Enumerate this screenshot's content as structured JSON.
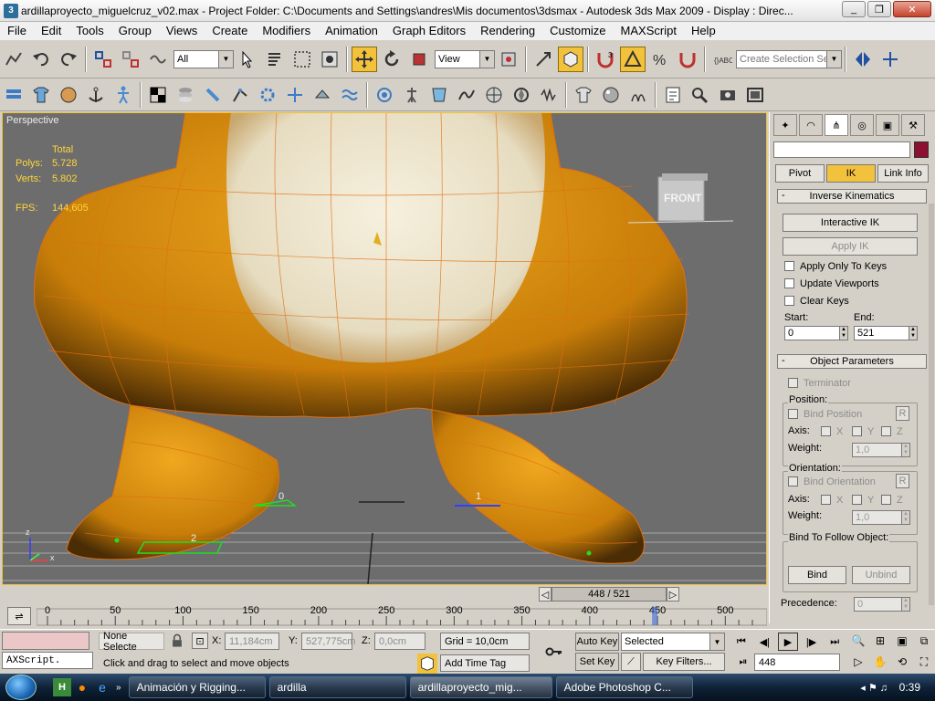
{
  "window": {
    "title": "ardillaproyecto_miguelcruz_v02.max    - Project Folder: C:\\Documents and Settings\\andres\\Mis documentos\\3dsmax    - Autodesk 3ds Max  2009      - Display : Direc..."
  },
  "menu": [
    "File",
    "Edit",
    "Tools",
    "Group",
    "Views",
    "Create",
    "Modifiers",
    "Animation",
    "Graph Editors",
    "Rendering",
    "Customize",
    "MAXScript",
    "Help"
  ],
  "toolbar": {
    "selection_filter": "All",
    "reference_coord": "View",
    "named_selection_placeholder": "Create Selection Set",
    "snap_angle": "3"
  },
  "viewport": {
    "label": "Perspective",
    "stats_header": "Total",
    "polys_label": "Polys:",
    "polys_value": "5.728",
    "verts_label": "Verts:",
    "verts_value": "5.802",
    "fps_label": "FPS:",
    "fps_value": "144,605",
    "viewcube_label": "FRONT",
    "marker_0": "0",
    "marker_1": "1",
    "marker_2": "2",
    "axis_z": "z",
    "axis_x": "x"
  },
  "command_panel": {
    "tabs": [
      "Pivot",
      "IK",
      "Link Info"
    ],
    "active_tab": "IK",
    "ik_rollout": "Inverse Kinematics",
    "interactive_ik": "Interactive IK",
    "apply_ik": "Apply IK",
    "apply_only_keys": "Apply Only To Keys",
    "update_viewports": "Update Viewports",
    "clear_keys": "Clear Keys",
    "start_label": "Start:",
    "start_value": "0",
    "end_label": "End:",
    "end_value": "521",
    "object_rollout": "Object Parameters",
    "terminator": "Terminator",
    "position_label": "Position:",
    "bind_position": "Bind Position",
    "r_button": "R",
    "axis_label": "Axis:",
    "axis_x": "X",
    "axis_y": "Y",
    "axis_z": "Z",
    "weight_label": "Weight:",
    "weight_value": "1,0",
    "orientation_label": "Orientation:",
    "bind_orientation": "Bind Orientation",
    "bind_follow": "Bind To Follow Object:",
    "bind_button": "Bind",
    "unbind_button": "Unbind",
    "precedence_label": "Precedence:",
    "precedence_value": "0"
  },
  "timeline": {
    "frame_label": "448 / 521",
    "current_frame": 448,
    "total_frames": 521,
    "ticks": [
      "0",
      "50",
      "100",
      "150",
      "200",
      "250",
      "300",
      "350",
      "400",
      "450",
      "500"
    ]
  },
  "status": {
    "selection": "None Selecte",
    "x_label": "X:",
    "x_value": "11,184cm",
    "y_label": "Y:",
    "y_value": "527,775cm",
    "z_label": "Z:",
    "z_value": "0,0cm",
    "grid": "Grid = 10,0cm",
    "add_time_tag": "Add Time Tag",
    "prompt": "Click and drag to select and move objects",
    "maxscript": "AXScript.",
    "auto_key": "Auto Key",
    "set_key": "Set Key",
    "key_mode": "Selected",
    "key_filters": "Key Filters...",
    "frame_field": "448"
  },
  "taskbar": {
    "tasks": [
      "Animación y Rigging...",
      "ardilla",
      "ardillaproyecto_mig...",
      "Adobe Photoshop C..."
    ],
    "clock": "0:39"
  },
  "colors": {
    "accent": "#f2c23c",
    "viewport_bg": "#6d6d6d",
    "wire": "#e07010",
    "body": "#d9920c"
  }
}
